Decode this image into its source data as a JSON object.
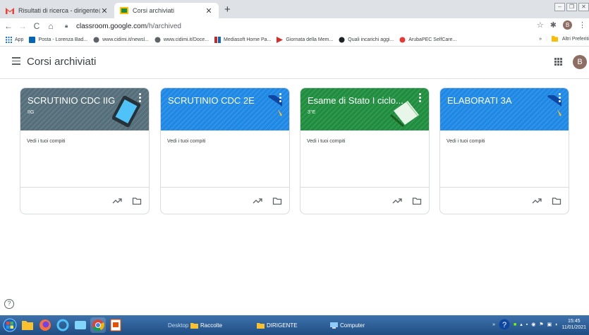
{
  "browser": {
    "tabs": [
      {
        "title": "Risultati di ricerca - dirigente@ic",
        "active": false
      },
      {
        "title": "Corsi archiviati",
        "active": true
      }
    ],
    "new_tab": "+",
    "window_controls": {
      "minimize": "–",
      "restore": "❐",
      "close": "✕"
    },
    "url_domain": "classroom.google.com",
    "url_path": "/h/archived",
    "profile_initial": "B"
  },
  "bookmarks": {
    "apps_label": "App",
    "items": [
      "Posta - Lorenza Bad...",
      "www.cidimi.it/newsl...",
      "www.cidimi.it/Doce...",
      "Mediasoft Home Pa...",
      "Giornata della Mem...",
      "Quali incarichi aggi...",
      "ArubaPEC SelfCare..."
    ],
    "overflow": "»",
    "other_label": "Altri Preferiti"
  },
  "app": {
    "title": "Corsi archiviati",
    "avatar_initial": "B",
    "colors": {
      "slate": "#546e7a",
      "blue": "#1e88e5",
      "green": "#1e8e3e"
    }
  },
  "courses": [
    {
      "name": "SCRUTINIO CDC IIG",
      "section": "IIG",
      "tasks_label": "Vedi i tuoi compiti",
      "theme": "slate"
    },
    {
      "name": "SCRUTINIO CDC 2E",
      "section": "",
      "tasks_label": "Vedi i tuoi compiti",
      "theme": "blue"
    },
    {
      "name": "Esame di Stato I ciclo...",
      "section": "3°E",
      "tasks_label": "Vedi i tuoi compiti",
      "theme": "green"
    },
    {
      "name": "ELABORATI 3A",
      "section": "",
      "tasks_label": "Vedi i tuoi compiti",
      "theme": "blue"
    }
  ],
  "help_label": "?",
  "taskbar": {
    "items": [
      "Desktop",
      "Raccolte",
      "DIRIGENTE",
      "Computer"
    ],
    "tray_overflow": "»",
    "time": "15:45",
    "date": "11/01/2021"
  }
}
